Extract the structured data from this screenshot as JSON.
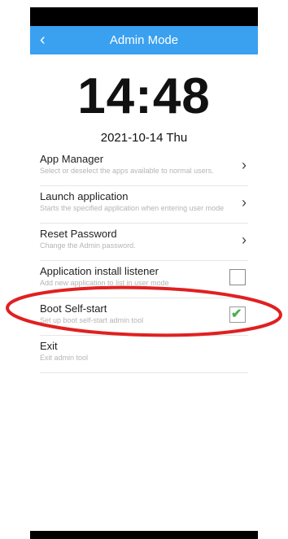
{
  "appbar": {
    "back_glyph": "‹",
    "title": "Admin Mode"
  },
  "clock": {
    "time": "14:48",
    "date": "2021-10-14 Thu"
  },
  "items": [
    {
      "title": "App Manager",
      "subtitle": "Select or deselect the apps available to normal users.",
      "control": "chevron"
    },
    {
      "title": "Launch application",
      "subtitle": "Starts the specified application when entering user mode",
      "control": "chevron"
    },
    {
      "title": "Reset Password",
      "subtitle": "Change the Admin password.",
      "control": "chevron"
    },
    {
      "title": "Application install listener",
      "subtitle": "Add new application to list in user mode",
      "control": "checkbox",
      "checked": false
    },
    {
      "title": "Boot Self-start",
      "subtitle": "Set up boot self-start admin tool",
      "control": "checkbox",
      "checked": true
    },
    {
      "title": "Exit",
      "subtitle": "Exit admin tool",
      "control": "none"
    }
  ],
  "glyphs": {
    "chevron": "›",
    "check": "✔"
  },
  "colors": {
    "appbar": "#3aa0f0",
    "annotation_ring": "#e02020",
    "check": "#4caf50"
  }
}
